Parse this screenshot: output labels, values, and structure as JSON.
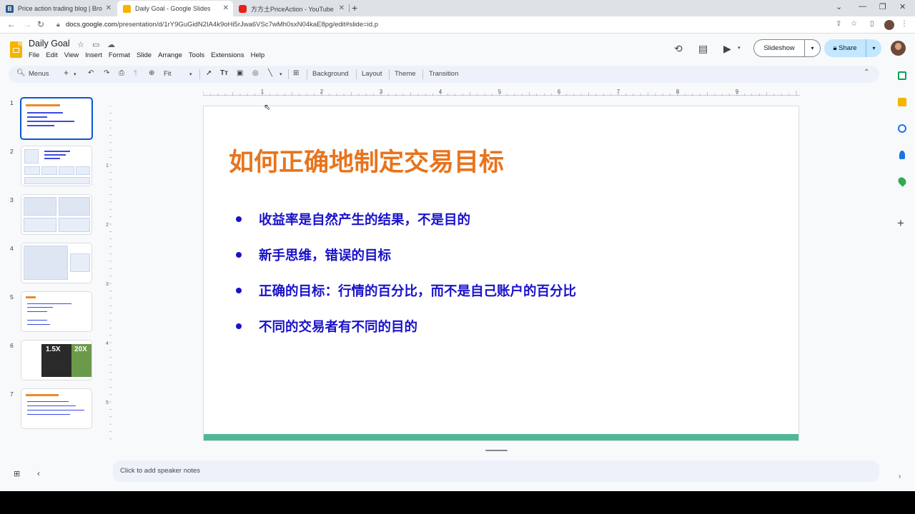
{
  "browser": {
    "tabs": [
      {
        "title": "Price action trading blog | Bro",
        "favicon_letter": "B"
      },
      {
        "title": "Daily Goal - Google Slides",
        "favicon_letter": ""
      },
      {
        "title": "方方土PriceAction - YouTube",
        "favicon_letter": ""
      }
    ],
    "url_host": "docs.google.com",
    "url_path": "/presentation/d/1rY9GuGidN2IA4k9oHi5rJwa6VSc7wMh0sxN04kaE8pg/edit#slide=id.p"
  },
  "docs": {
    "title": "Daily Goal",
    "menu": [
      "File",
      "Edit",
      "View",
      "Insert",
      "Format",
      "Slide",
      "Arrange",
      "Tools",
      "Extensions",
      "Help"
    ],
    "slideshow_label": "Slideshow",
    "share_label": "Share"
  },
  "toolbar": {
    "menus_label": "Menus",
    "zoom_label": "Fit",
    "background_label": "Background",
    "layout_label": "Layout",
    "theme_label": "Theme",
    "transition_label": "Transition"
  },
  "filmstrip": {
    "numbers": [
      "1",
      "2",
      "3",
      "4",
      "5",
      "6",
      "7"
    ],
    "slide6_labels": [
      "1.5X",
      "20X"
    ]
  },
  "ruler": {
    "h_labels": [
      "1",
      "2",
      "3",
      "4",
      "5",
      "6",
      "7",
      "8",
      "9"
    ],
    "v_labels": [
      "1",
      "2",
      "3",
      "4",
      "5"
    ]
  },
  "slide": {
    "title": "如何正确地制定交易目标",
    "bullets": [
      "收益率是自然产生的结果，不是目的",
      "新手思维，错误的目标",
      "正确的目标：行情的百分比，而不是自己账户的百分比",
      "不同的交易者有不同的目的"
    ],
    "title_color": "#e8741d",
    "bullet_color": "#1a12c9",
    "accent_bar_color": "#4fb89a"
  },
  "notes": {
    "placeholder": "Click to add speaker notes"
  }
}
